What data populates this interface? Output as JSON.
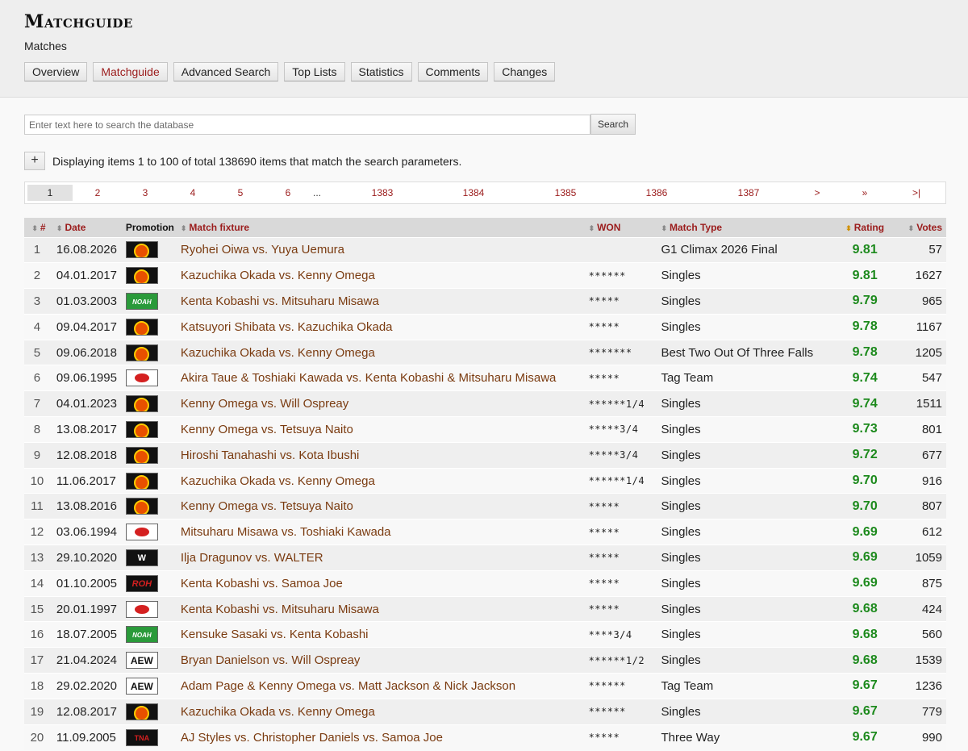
{
  "header": {
    "title": "Matchguide",
    "subtitle": "Matches",
    "tabs": [
      {
        "label": "Overview",
        "active": false
      },
      {
        "label": "Matchguide",
        "active": true
      },
      {
        "label": "Advanced Search",
        "active": false
      },
      {
        "label": "Top Lists",
        "active": false
      },
      {
        "label": "Statistics",
        "active": false
      },
      {
        "label": "Comments",
        "active": false
      },
      {
        "label": "Changes",
        "active": false
      }
    ]
  },
  "search": {
    "placeholder": "Enter text here to search the database",
    "button_label": "Search"
  },
  "results": {
    "expand_label": "+",
    "info": "Displaying items 1 to 100 of total 138690 items that match the search parameters."
  },
  "pager": [
    "1",
    "2",
    "3",
    "4",
    "5",
    "6",
    "...",
    "1383",
    "1384",
    "1385",
    "1386",
    "1387",
    ">",
    "»",
    ">|"
  ],
  "table": {
    "columns": [
      "#",
      "Date",
      "Promotion",
      "Match fixture",
      "WON",
      "Match Type",
      "Rating",
      "Votes"
    ],
    "rows": [
      {
        "num": "1",
        "date": "16.08.2026",
        "promo": "njpw",
        "fixture": "Ryohei Oiwa vs. Yuya Uemura",
        "won": "",
        "type": "G1 Climax 2026 Final",
        "rating": "9.81",
        "votes": "57"
      },
      {
        "num": "2",
        "date": "04.01.2017",
        "promo": "njpw",
        "fixture": "Kazuchika Okada vs. Kenny Omega",
        "won": "******",
        "type": "Singles",
        "rating": "9.81",
        "votes": "1627"
      },
      {
        "num": "3",
        "date": "01.03.2003",
        "promo": "noah",
        "fixture": "Kenta Kobashi vs. Mitsuharu Misawa",
        "won": "*****",
        "type": "Singles",
        "rating": "9.79",
        "votes": "965"
      },
      {
        "num": "4",
        "date": "09.04.2017",
        "promo": "njpw",
        "fixture": "Katsuyori Shibata vs. Kazuchika Okada",
        "won": "*****",
        "type": "Singles",
        "rating": "9.78",
        "votes": "1167"
      },
      {
        "num": "5",
        "date": "09.06.2018",
        "promo": "njpw",
        "fixture": "Kazuchika Okada vs. Kenny Omega",
        "won": "*******",
        "type": "Best Two Out Of Three Falls",
        "rating": "9.78",
        "votes": "1205"
      },
      {
        "num": "6",
        "date": "09.06.1995",
        "promo": "ajpw",
        "fixture": "Akira Taue & Toshiaki Kawada vs. Kenta Kobashi & Mitsuharu Misawa",
        "won": "*****",
        "type": "Tag Team",
        "rating": "9.74",
        "votes": "547"
      },
      {
        "num": "7",
        "date": "04.01.2023",
        "promo": "njpw",
        "fixture": "Kenny Omega vs. Will Ospreay",
        "won": "******1/4",
        "type": "Singles",
        "rating": "9.74",
        "votes": "1511"
      },
      {
        "num": "8",
        "date": "13.08.2017",
        "promo": "njpw",
        "fixture": "Kenny Omega vs. Tetsuya Naito",
        "won": "*****3/4",
        "type": "Singles",
        "rating": "9.73",
        "votes": "801"
      },
      {
        "num": "9",
        "date": "12.08.2018",
        "promo": "njpw",
        "fixture": "Hiroshi Tanahashi vs. Kota Ibushi",
        "won": "*****3/4",
        "type": "Singles",
        "rating": "9.72",
        "votes": "677"
      },
      {
        "num": "10",
        "date": "11.06.2017",
        "promo": "njpw",
        "fixture": "Kazuchika Okada vs. Kenny Omega",
        "won": "******1/4",
        "type": "Singles",
        "rating": "9.70",
        "votes": "916"
      },
      {
        "num": "11",
        "date": "13.08.2016",
        "promo": "njpw",
        "fixture": "Kenny Omega vs. Tetsuya Naito",
        "won": "*****",
        "type": "Singles",
        "rating": "9.70",
        "votes": "807"
      },
      {
        "num": "12",
        "date": "03.06.1994",
        "promo": "ajpw",
        "fixture": "Mitsuharu Misawa vs. Toshiaki Kawada",
        "won": "*****",
        "type": "Singles",
        "rating": "9.69",
        "votes": "612"
      },
      {
        "num": "13",
        "date": "29.10.2020",
        "promo": "wwe",
        "fixture": "Ilja Dragunov vs. WALTER",
        "won": "*****",
        "type": "Singles",
        "rating": "9.69",
        "votes": "1059"
      },
      {
        "num": "14",
        "date": "01.10.2005",
        "promo": "roh",
        "fixture": "Kenta Kobashi vs. Samoa Joe",
        "won": "*****",
        "type": "Singles",
        "rating": "9.69",
        "votes": "875"
      },
      {
        "num": "15",
        "date": "20.01.1997",
        "promo": "ajpw",
        "fixture": "Kenta Kobashi vs. Mitsuharu Misawa",
        "won": "*****",
        "type": "Singles",
        "rating": "9.68",
        "votes": "424"
      },
      {
        "num": "16",
        "date": "18.07.2005",
        "promo": "noah",
        "fixture": "Kensuke Sasaki vs. Kenta Kobashi",
        "won": "****3/4",
        "type": "Singles",
        "rating": "9.68",
        "votes": "560"
      },
      {
        "num": "17",
        "date": "21.04.2024",
        "promo": "aew",
        "fixture": "Bryan Danielson vs. Will Ospreay",
        "won": "******1/2",
        "type": "Singles",
        "rating": "9.68",
        "votes": "1539"
      },
      {
        "num": "18",
        "date": "29.02.2020",
        "promo": "aew",
        "fixture": "Adam Page & Kenny Omega vs. Matt Jackson & Nick Jackson",
        "won": "******",
        "type": "Tag Team",
        "rating": "9.67",
        "votes": "1236"
      },
      {
        "num": "19",
        "date": "12.08.2017",
        "promo": "njpw",
        "fixture": "Kazuchika Okada vs. Kenny Omega",
        "won": "******",
        "type": "Singles",
        "rating": "9.67",
        "votes": "779"
      },
      {
        "num": "20",
        "date": "11.09.2005",
        "promo": "tna",
        "fixture": "AJ Styles vs. Christopher Daniels vs. Samoa Joe",
        "won": "*****",
        "type": "Three Way",
        "rating": "9.67",
        "votes": "990"
      }
    ]
  }
}
